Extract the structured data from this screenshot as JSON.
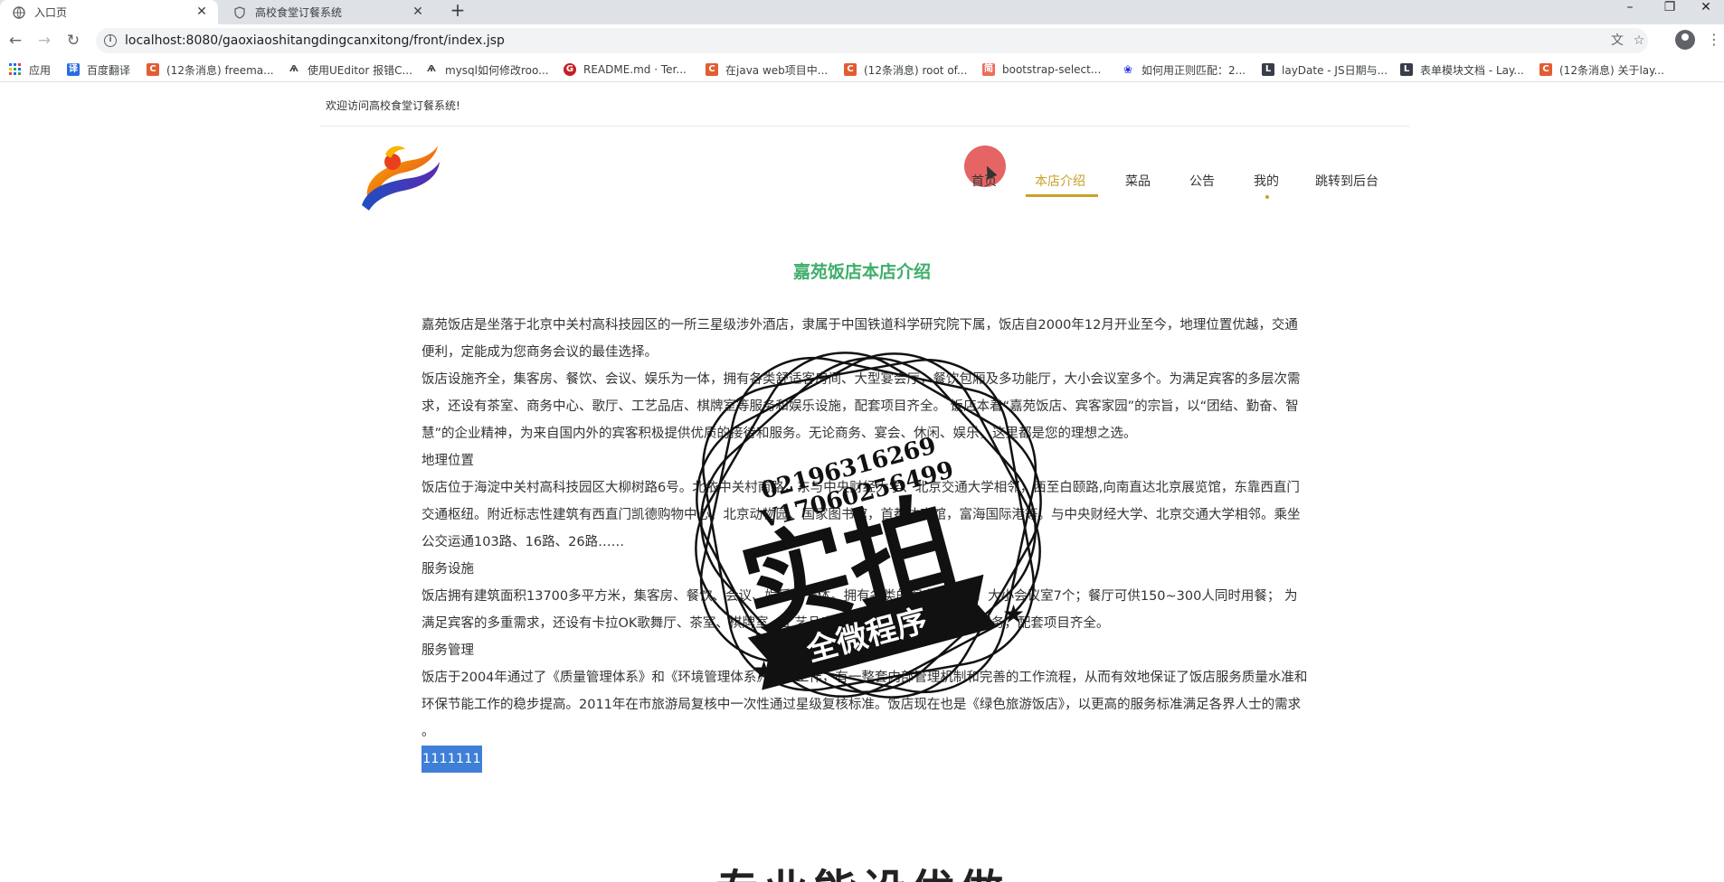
{
  "browser": {
    "tabs": [
      {
        "title": "入口页",
        "active": true
      },
      {
        "title": "高校食堂订餐系统",
        "active": false
      }
    ],
    "url": "localhost:8080/gaoxiaoshitangdingcanxitong/front/index.jsp",
    "bookmarks": [
      {
        "label": "应用",
        "icon": "apps-grid-icon",
        "color": "#1a73e8"
      },
      {
        "label": "百度翻译",
        "icon": "translate-icon",
        "color": "#2b6cde"
      },
      {
        "label": "(12条消息) freema...",
        "icon": "csdn-icon",
        "color": "#e35c32"
      },
      {
        "label": "使用UEditor 报错C...",
        "icon": "wolf-icon",
        "color": "#444444"
      },
      {
        "label": "mysql如何修改roo...",
        "icon": "wolf-icon",
        "color": "#444444"
      },
      {
        "label": "README.md · Ter...",
        "icon": "gitee-icon",
        "color": "#c71d23"
      },
      {
        "label": "在java web项目中...",
        "icon": "csdn-icon",
        "color": "#e35c32"
      },
      {
        "label": "(12条消息) root of...",
        "icon": "csdn-icon",
        "color": "#e35c32"
      },
      {
        "label": "bootstrap-select...",
        "icon": "jianshu-icon",
        "color": "#ea6f5a"
      },
      {
        "label": "如何用正则匹配：2...",
        "icon": "baidu-paw-icon",
        "color": "#2932e1"
      },
      {
        "label": "layDate - JS日期与...",
        "icon": "layui-icon",
        "color": "#393d49"
      },
      {
        "label": "表单模块文档 - Lay...",
        "icon": "layui-icon",
        "color": "#393d49"
      },
      {
        "label": "(12条消息) 关于lay...",
        "icon": "csdn-icon",
        "color": "#e35c32"
      }
    ]
  },
  "site": {
    "welcome": "欢迎访问高校食堂订餐系统!",
    "nav": [
      {
        "label": "首页",
        "active": false
      },
      {
        "label": "本店介绍",
        "active": true
      },
      {
        "label": "菜品",
        "active": false
      },
      {
        "label": "公告",
        "active": false
      },
      {
        "label": "我的",
        "active": false
      },
      {
        "label": "跳转到后台",
        "active": false
      }
    ],
    "accent_color": "#c9a227",
    "title_color": "#3fae6b"
  },
  "intro": {
    "title": "嘉苑饭店本店介绍",
    "paragraphs": [
      "嘉苑饭店是坐落于北京中关村高科技园区的一所三星级涉外酒店，隶属于中国铁道科学研究院下属，饭店自2000年12月开业至今，地理位置优越，交通便利，定能成为您商务会议的最佳选择。",
      "饭店设施齐全，集客房、餐饮、会议、娱乐为一体，拥有各类舒适客房间、大型宴会厅，餐饮包厢及多功能厅，大小会议室多个。为满足宾客的多层次需求，还设有茶室、商务中心、歌厅、工艺品店、棋牌室等服务和娱乐设施，配套项目齐全。 饭店本着“嘉苑饭店、宾客家园”的宗旨，以“团结、勤奋、智慧”的企业精神，为来自国内外的宾客积极提供优质的接待和服务。无论商务、宴会、休闲、娱乐，这里都是您的理想之选。",
      "地理位置",
      "饭店位于海淀中关村高科技园区大柳树路6号。北依中关村南路，东与中央财经大学、北京交通大学相邻，西至白颐路,向南直达北京展览馆，东靠西直门交通枢纽。附近标志性建筑有西直门凯德购物中心、北京动物园、国家图书馆，首都体育馆，富海国际港等。与中央财经大学、北京交通大学相邻。乘坐公交运通103路、16路、26路……",
      "服务设施",
      "饭店拥有建筑面积13700多平方米，集客房、餐饮、会议、娱乐为一体。拥有各类的客房百余间，大小会议室7个；餐厅可供150~300人同时用餐； 为满足宾客的多重需求，还设有卡拉OK歌舞厅、茶室、棋牌室、工艺品店、商务中心等娱乐设施和服务，配套项目齐全。",
      "服务管理",
      "饭店于2004年通过了《质量管理体系》和《环境管理体系》认证工作，有一整套内部管理机制和完善的工作流程，从而有效地保证了饭店服务质量水准和环保节能工作的稳步提高。2011年在市旅游局复核中一次性通过星级复核标准。饭店现在也是《绿色旅游饭店》，以更高的服务标准满足各界人士的需求 。"
    ],
    "highlighted": "1111111"
  },
  "bottom_heading": "专业能设优做",
  "watermark": {
    "line1": "02196316269",
    "line2": "V17060256499",
    "big": "实拍",
    "banner": "全微程序"
  }
}
